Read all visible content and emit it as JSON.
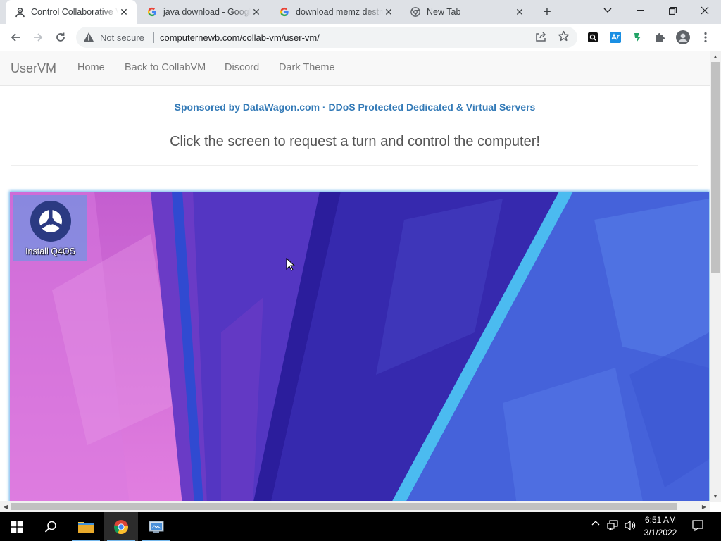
{
  "browser": {
    "tabs": [
      {
        "title": "Control Collaborative Virtual Machines",
        "favicon": "collabvm-icon",
        "active": true
      },
      {
        "title": "java download - Google Search",
        "favicon": "google-icon",
        "active": false
      },
      {
        "title": "download memz destructive",
        "favicon": "google-icon",
        "active": false
      },
      {
        "title": "New Tab",
        "favicon": "chrome-icon",
        "active": false
      }
    ],
    "security_label": "Not secure",
    "url": "computernewb.com/collab-vm/user-vm/"
  },
  "page": {
    "brand": "UserVM",
    "nav": [
      "Home",
      "Back to CollabVM",
      "Discord",
      "Dark Theme"
    ],
    "sponsor": "Sponsored by DataWagon.com · DDoS Protected Dedicated & Virtual Servers",
    "lead": "Click the screen to request a turn and control the computer!",
    "vm_desktop": {
      "icons": [
        {
          "label": "Install Q4OS",
          "icon": "q4os-installer-icon"
        }
      ]
    }
  },
  "taskbar": {
    "apps": [
      "file-explorer-icon",
      "chrome-icon",
      "control-panel-icon"
    ],
    "time": "6:51 AM",
    "date": "3/1/2022"
  },
  "colors": {
    "link": "#337ab7",
    "tabstrip": "#dee1e6",
    "taskbar": "#000000"
  }
}
